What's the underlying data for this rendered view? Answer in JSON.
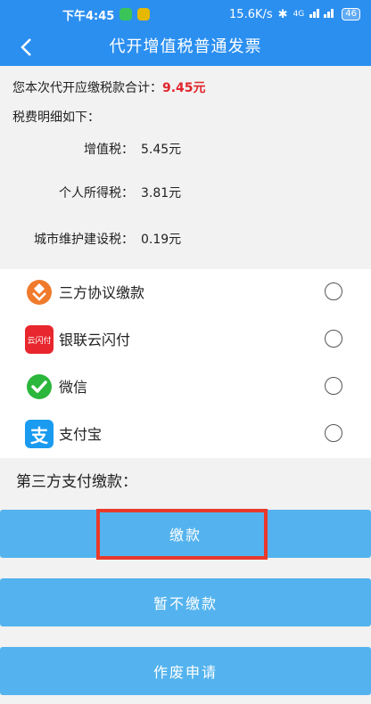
{
  "status_bar": {
    "time": "下午4:45",
    "network_speed": "15.6K/s",
    "signal_text": "4G",
    "battery": "46"
  },
  "header": {
    "title": "代开增值税普通发票"
  },
  "summary": {
    "total_label": "您本次代开应缴税款合计：",
    "total_amount": "9.45元",
    "detail_label": "税费明细如下：",
    "taxes": [
      {
        "name": "增值税：",
        "value": "5.45元"
      },
      {
        "name": "个人所得税：",
        "value": "3.81元"
      },
      {
        "name": "城市维护建设税：",
        "value": "0.19元"
      }
    ]
  },
  "payment_methods": [
    {
      "label": "三方协议缴款",
      "icon": "tax-bureau-icon",
      "selected": false
    },
    {
      "label": "银联云闪付",
      "icon": "unionpay-icon",
      "logo_text": "云闪付",
      "selected": false
    },
    {
      "label": "微信",
      "icon": "wechat-icon",
      "selected": false
    },
    {
      "label": "支付宝",
      "icon": "alipay-icon",
      "logo_text": "支",
      "selected": false
    }
  ],
  "third_party_label": "第三方支付缴款：",
  "buttons": {
    "pay": "缴款",
    "defer": "暂不缴款",
    "void": "作废申请"
  },
  "colors": {
    "brand_blue": "#2b8ff0",
    "button_blue": "#54b3ee",
    "amount_red": "#e0252b",
    "highlight_red": "#e8392b"
  }
}
